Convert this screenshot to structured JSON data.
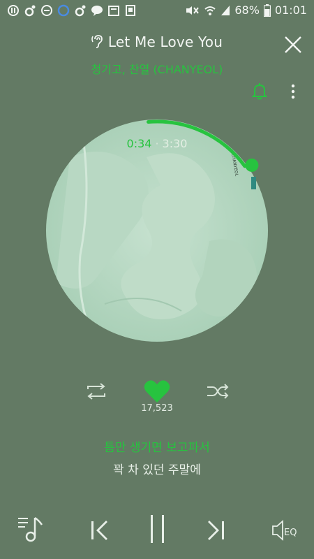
{
  "status_bar": {
    "battery": "68%",
    "time": "01:01"
  },
  "player": {
    "title": "Let Me Love You",
    "artist": "청기고, 찬열 (CHANYEOL)",
    "elapsed": "0:34",
    "separator": "·",
    "duration": "3:30",
    "progress_fraction": 0.162,
    "likes": "17,523",
    "lyrics": [
      "틈만 생기면 보고파서",
      "꽉 차 있던 주말에"
    ],
    "eq_label": "EQ",
    "album_text": "CHANYEOL"
  },
  "icons": {
    "hearing": "hearing-icon",
    "close": "close-icon",
    "bell": "bell-icon",
    "more": "more-vertical-icon",
    "repeat": "repeat-icon",
    "heart": "heart-icon",
    "shuffle": "shuffle-icon",
    "playlist": "playlist-icon",
    "previous": "previous-icon",
    "pause": "pause-icon",
    "next": "next-icon",
    "equalizer": "equalizer-icon"
  },
  "colors": {
    "background": "#637a64",
    "accent_green": "#27c33f",
    "text_light": "#f2f5f2"
  }
}
